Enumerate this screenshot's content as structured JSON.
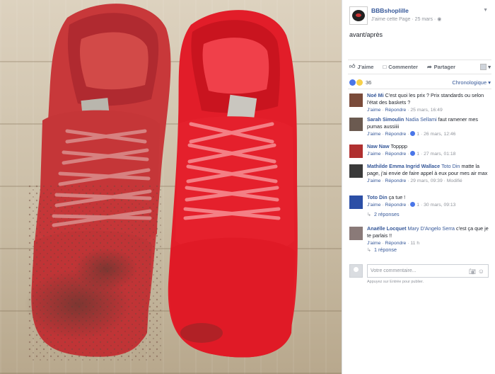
{
  "post": {
    "page_name": "BBBshoplille",
    "like_page": "J'aime cette Page",
    "date": "25 mars",
    "text": "avant/après"
  },
  "actions": {
    "like": "J'aime",
    "comment": "Commenter",
    "share": "Partager"
  },
  "stats": {
    "reaction_count": "36",
    "order": "Chronologique"
  },
  "comments": [
    {
      "name": "Noé Mi",
      "tag": "",
      "text": "C'est quoi les prix ? Prix standards ou selon l'état des baskets ?",
      "like": "J'aime",
      "reply": "Répondre",
      "likes": "",
      "time": "25 mars, 16:49",
      "avatar_color": "#7a4b3a"
    },
    {
      "name": "Sarah Simoulin",
      "tag": "Nadia Sellami",
      "text": "faut ramener mes pumas aussiiii",
      "like": "J'aime",
      "reply": "Répondre",
      "likes": "1",
      "time": "26 mars, 12:46",
      "avatar_color": "#6b5a50"
    },
    {
      "name": "Naw Naw",
      "tag": "",
      "text": "Topppp",
      "like": "J'aime",
      "reply": "Répondre",
      "likes": "1",
      "time": "27 mars, 01:18",
      "avatar_color": "#b03030"
    },
    {
      "name": "Mathilde Emma Ingrid Wallace",
      "tag": "Toto Din",
      "text": "matte la page, j'ai envie de faire appel à eux pour mes air max",
      "like": "J'aime",
      "reply": "Répondre",
      "likes": "",
      "time": "29 mars, 09:39 · Modifié",
      "avatar_color": "#3a3a3a"
    },
    {
      "name": "Toto Din",
      "tag": "",
      "text": "ça tue !",
      "like": "J'aime",
      "reply": "Répondre",
      "likes": "1",
      "time": "30 mars, 09:13",
      "avatar_color": "#2c4fa6",
      "replies": "2 réponses"
    },
    {
      "name": "Anaëlle Locquet",
      "tag": "Mary D'Angelo Serra",
      "text": "c'est ça que je te parlais !!",
      "like": "J'aime",
      "reply": "Répondre",
      "likes": "",
      "time": "11 h",
      "avatar_color": "#8a7a78",
      "replies": "1 réponse"
    }
  ],
  "composer": {
    "placeholder": "Votre commentaire...",
    "hint": "Appuyez sur Entrée pour publier."
  },
  "colors": {
    "link": "#365899",
    "meta": "#90949c",
    "shoe_dirty": "#c93a3a",
    "shoe_clean": "#e41f2c"
  }
}
